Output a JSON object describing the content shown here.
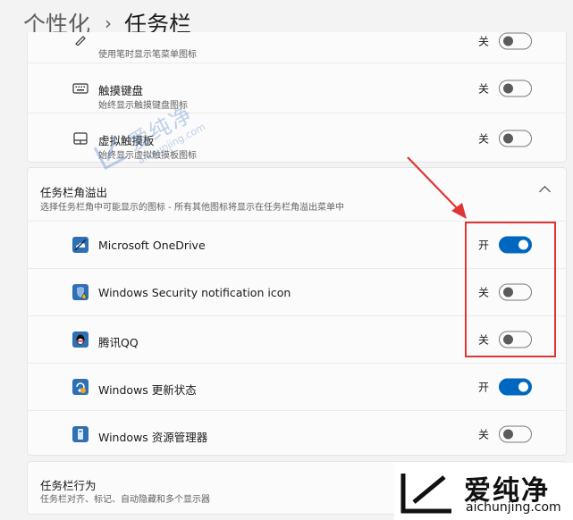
{
  "breadcrumb": {
    "parent": "个性化",
    "separator": "›",
    "current": "任务栏"
  },
  "system_icons": [
    {
      "title": "",
      "subtitle": "使用笔时显示笔菜单图标",
      "state": "关",
      "on": false,
      "icon": "pen-icon"
    },
    {
      "title": "触摸键盘",
      "subtitle": "始终显示触摸键盘图标",
      "state": "关",
      "on": false,
      "icon": "keyboard-icon"
    },
    {
      "title": "虚拟触摸板",
      "subtitle": "始终显示虚拟触摸板图标",
      "state": "关",
      "on": false,
      "icon": "touchpad-icon"
    }
  ],
  "overflow": {
    "title": "任务栏角溢出",
    "subtitle": "选择任务栏角中可能显示的图标 - 所有其他图标将显示在任务栏角溢出菜单中",
    "items": [
      {
        "title": "Microsoft OneDrive",
        "state": "开",
        "on": true,
        "icon": "onedrive-icon"
      },
      {
        "title": "Windows Security notification icon",
        "state": "关",
        "on": false,
        "icon": "security-warning-icon"
      },
      {
        "title": "腾讯QQ",
        "state": "关",
        "on": false,
        "icon": "qq-icon"
      },
      {
        "title": "Windows 更新状态",
        "state": "开",
        "on": true,
        "icon": "windows-update-icon"
      },
      {
        "title": "Windows 资源管理器",
        "state": "关",
        "on": false,
        "icon": "explorer-icon"
      }
    ]
  },
  "behavior": {
    "title": "任务栏行为",
    "subtitle": "任务栏对齐、标记、自动隐藏和多个显示器"
  },
  "watermark": {
    "name": "爱纯净",
    "url": "aichunjing.com"
  },
  "colors": {
    "accent": "#0067c0",
    "highlight": "#e03535"
  }
}
